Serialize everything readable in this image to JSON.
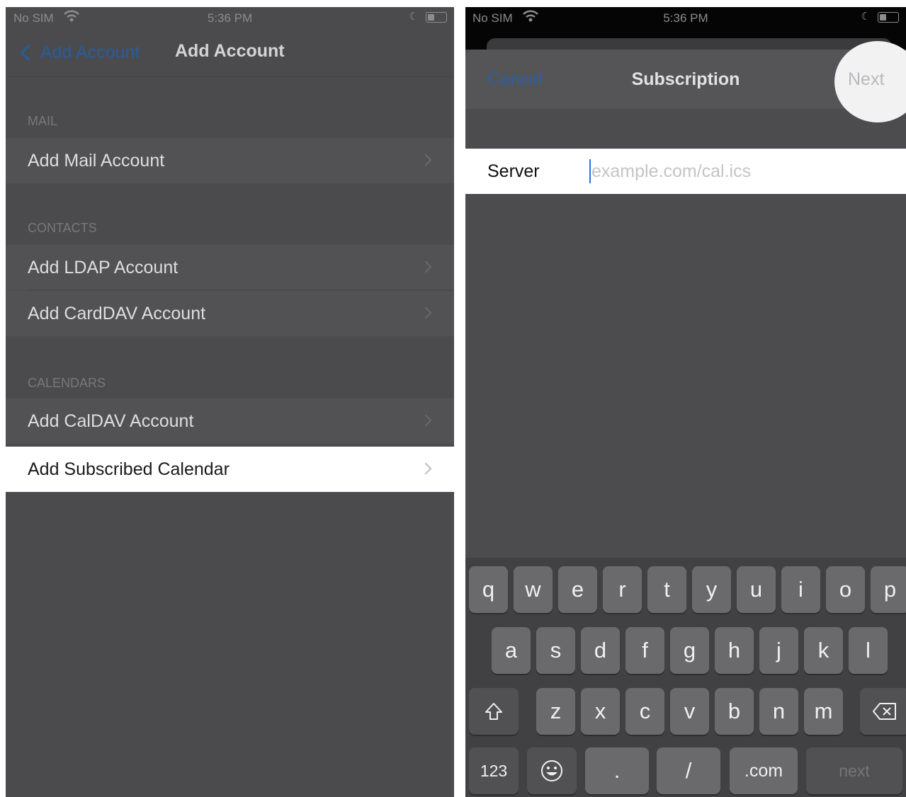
{
  "status_bar": {
    "carrier": "No SIM",
    "time": "5:36 PM"
  },
  "left": {
    "nav": {
      "back_label": "Add Account",
      "title": "Add Account"
    },
    "sections": [
      {
        "header": "MAIL",
        "rows": [
          "Add Mail Account"
        ]
      },
      {
        "header": "CONTACTS",
        "rows": [
          "Add LDAP Account",
          "Add CardDAV Account"
        ]
      },
      {
        "header": "CALENDARS",
        "rows": [
          "Add CalDAV Account",
          "Add Subscribed Calendar"
        ]
      }
    ]
  },
  "right": {
    "nav": {
      "cancel_label": "Cancel",
      "title": "Subscription",
      "next_label": "Next"
    },
    "server": {
      "label": "Server",
      "placeholder": "example.com/cal.ics",
      "value": ""
    },
    "keyboard": {
      "row1": [
        "q",
        "w",
        "e",
        "r",
        "t",
        "y",
        "u",
        "i",
        "o",
        "p"
      ],
      "row2": [
        "a",
        "s",
        "d",
        "f",
        "g",
        "h",
        "j",
        "k",
        "l"
      ],
      "row3": [
        "z",
        "x",
        "c",
        "v",
        "b",
        "n",
        "m"
      ],
      "numbers_label": "123",
      "period_label": ".",
      "slash_label": "/",
      "dotcom_label": ".com",
      "return_label": "next"
    }
  },
  "colors": {
    "accent": "#2a5b9c",
    "dim_background": "#4b4b4d",
    "highlight": "#ffffff"
  }
}
